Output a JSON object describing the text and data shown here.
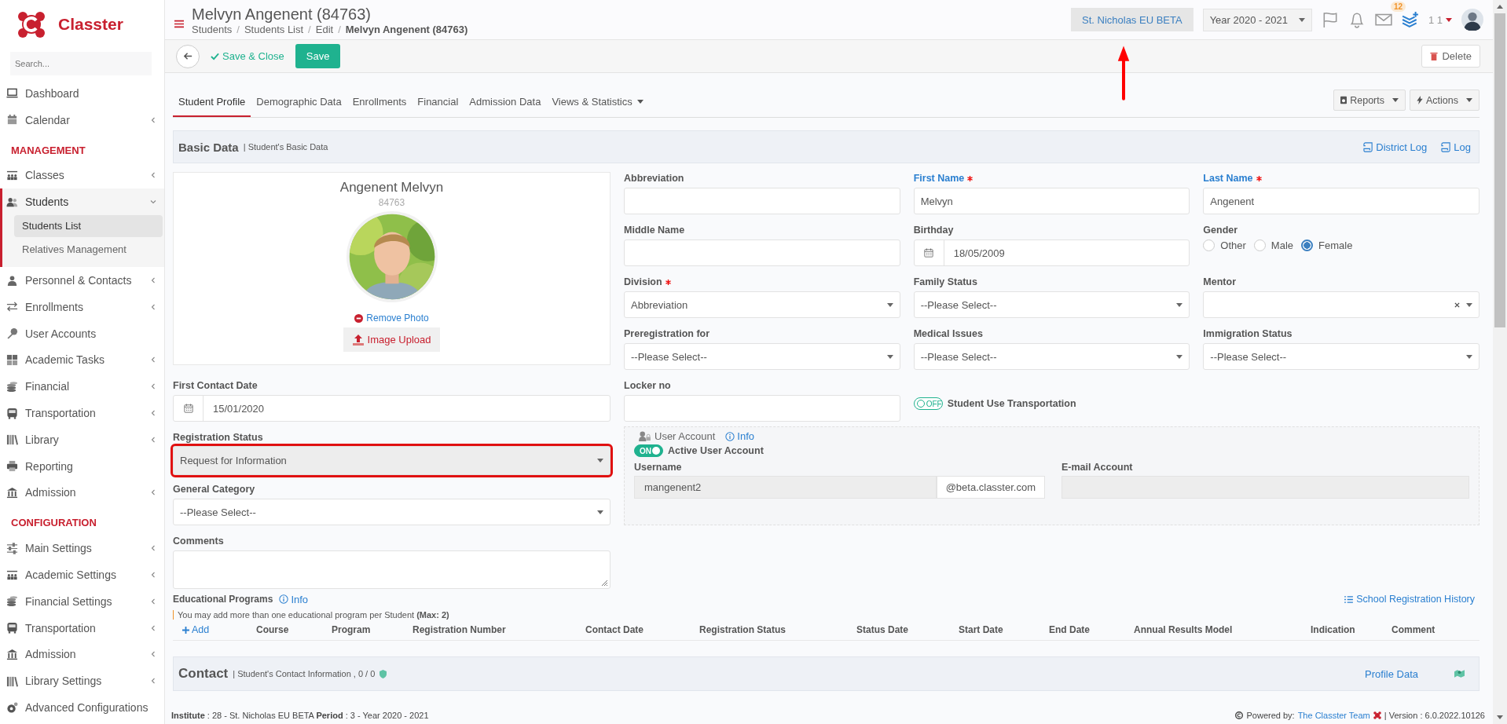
{
  "brand": {
    "name": "Classter"
  },
  "sidebar": {
    "search_placeholder": "Search...",
    "items": [
      {
        "kind": "item",
        "label": "Dashboard"
      },
      {
        "kind": "item",
        "label": "Calendar",
        "expanded": false
      },
      {
        "kind": "heading",
        "label": "MANAGEMENT"
      },
      {
        "kind": "item",
        "label": "Classes",
        "expanded": false
      },
      {
        "kind": "item",
        "label": "Students",
        "expanded": true,
        "children": [
          {
            "label": "Students List",
            "selected": true
          },
          {
            "label": "Relatives Management",
            "selected": false
          }
        ]
      },
      {
        "kind": "item",
        "label": "Personnel & Contacts",
        "expanded": false
      },
      {
        "kind": "item",
        "label": "Enrollments",
        "expanded": false
      },
      {
        "kind": "item",
        "label": "User Accounts"
      },
      {
        "kind": "item",
        "label": "Academic Tasks",
        "expanded": false
      },
      {
        "kind": "item",
        "label": "Financial",
        "expanded": false
      },
      {
        "kind": "item",
        "label": "Transportation",
        "expanded": false
      },
      {
        "kind": "item",
        "label": "Library",
        "expanded": false
      },
      {
        "kind": "item",
        "label": "Reporting"
      },
      {
        "kind": "item",
        "label": "Admission",
        "expanded": false
      },
      {
        "kind": "heading",
        "label": "CONFIGURATION"
      },
      {
        "kind": "item",
        "label": "Main Settings",
        "expanded": false
      },
      {
        "kind": "item",
        "label": "Academic Settings",
        "expanded": false
      },
      {
        "kind": "item",
        "label": "Financial Settings",
        "expanded": false
      },
      {
        "kind": "item",
        "label": "Transportation",
        "expanded": false
      },
      {
        "kind": "item",
        "label": "Admission",
        "expanded": false
      },
      {
        "kind": "item",
        "label": "Library Settings",
        "expanded": false
      },
      {
        "kind": "item",
        "label": "Advanced Configurations"
      }
    ]
  },
  "header": {
    "title": "Melvyn Angenent (84763)",
    "breadcrumb_separator": "/",
    "breadcrumbs": [
      "Students",
      "Students List",
      "Edit",
      "Melvyn Angenent (84763)"
    ],
    "school": "St. Nicholas EU BETA",
    "year": "Year 2020 - 2021",
    "mail_badge": "12",
    "user": "1 1"
  },
  "actions": {
    "save_close": "Save & Close",
    "save": "Save",
    "delete": "Delete"
  },
  "tabs": [
    {
      "label": "Student Profile",
      "selected": true
    },
    {
      "label": "Demographic Data",
      "selected": false
    },
    {
      "label": "Enrollments",
      "selected": false
    },
    {
      "label": "Financial",
      "selected": false
    },
    {
      "label": "Admission Data",
      "selected": false
    },
    {
      "label": "Views & Statistics",
      "selected": false,
      "kind": "dropdown"
    }
  ],
  "tab_buttons": [
    "Reports",
    "Actions"
  ],
  "section": {
    "title": "Basic Data",
    "subtitle": "| Student's Basic Data",
    "links": [
      "District Log",
      "Log"
    ]
  },
  "profile": {
    "name": "Angenent Melvyn",
    "id": "84763",
    "remove_photo": "Remove Photo",
    "upload": "Image Upload"
  },
  "form": {
    "fields": [
      {
        "kind": "text",
        "label": "Abbreviation"
      },
      {
        "kind": "text",
        "label": "First Name",
        "required": true,
        "accent": true,
        "value": "Melvyn"
      },
      {
        "kind": "text",
        "label": "Last Name",
        "required": true,
        "accent": true,
        "value": "Angenent"
      },
      {
        "kind": "text",
        "label": "Middle Name"
      },
      {
        "kind": "date",
        "label": "Birthday",
        "value": "18/05/2009"
      },
      {
        "kind": "radio",
        "label": "Gender",
        "options": [
          {
            "label": "Other",
            "selected": false
          },
          {
            "label": "Male",
            "selected": false
          },
          {
            "label": "Female",
            "selected": true
          }
        ]
      },
      {
        "kind": "select",
        "label": "Division",
        "required": true,
        "value": "Abbreviation"
      },
      {
        "kind": "select",
        "label": "Family Status",
        "value": "--Please Select--"
      },
      {
        "kind": "select",
        "label": "Mentor",
        "clearable": true
      },
      {
        "kind": "select",
        "label": "Preregistration for",
        "value": "--Please Select--"
      },
      {
        "kind": "select",
        "label": "Medical Issues",
        "value": "--Please Select--"
      },
      {
        "kind": "select",
        "label": "Immigration Status",
        "value": "--Please Select--"
      },
      {
        "kind": "date",
        "label": "First Contact Date",
        "value": "15/01/2020"
      },
      {
        "kind": "text",
        "label": "Locker no"
      },
      {
        "kind": "toggle",
        "label": "Student Use Transportation",
        "on": false,
        "switch_text": "OFF"
      },
      {
        "kind": "select",
        "label": "Registration Status",
        "value": "Request for Information",
        "highlighted": true
      },
      {
        "kind": "select",
        "label": "General Category",
        "value": "--Please Select--"
      },
      {
        "kind": "textarea",
        "label": "Comments"
      }
    ]
  },
  "user_account": {
    "title": "User Account",
    "info": "Info",
    "toggle": {
      "label": "Active User Account",
      "on": true,
      "switch_text": "ON"
    },
    "username_label": "Username",
    "username": "mangenent2",
    "domain": "@beta.classter.com",
    "email_label": "E-mail Account"
  },
  "programs": {
    "title": "Educational Programs",
    "info": "Info",
    "history": "School Registration History",
    "notice": "You may add more than one educational program per Student **(Max: 2)**",
    "add": "Add",
    "columns": [
      "Course",
      "Program",
      "Registration Number",
      "Contact Date",
      "Registration Status",
      "Status Date",
      "Start Date",
      "End Date",
      "Annual Results Model",
      "Indication",
      "Comment"
    ]
  },
  "contact": {
    "title": "Contact",
    "subtitle": "| Student's Contact Information , 0 / 0",
    "link": "Profile Data"
  },
  "footer": {
    "left": "**Institute** : 28 - St. Nicholas EU BETA **Period** : 3 - Year 2020 - 2021",
    "powered": "Powered by:",
    "team": "The Classter Team",
    "version": "| Version : 6.0.2022.10126"
  }
}
